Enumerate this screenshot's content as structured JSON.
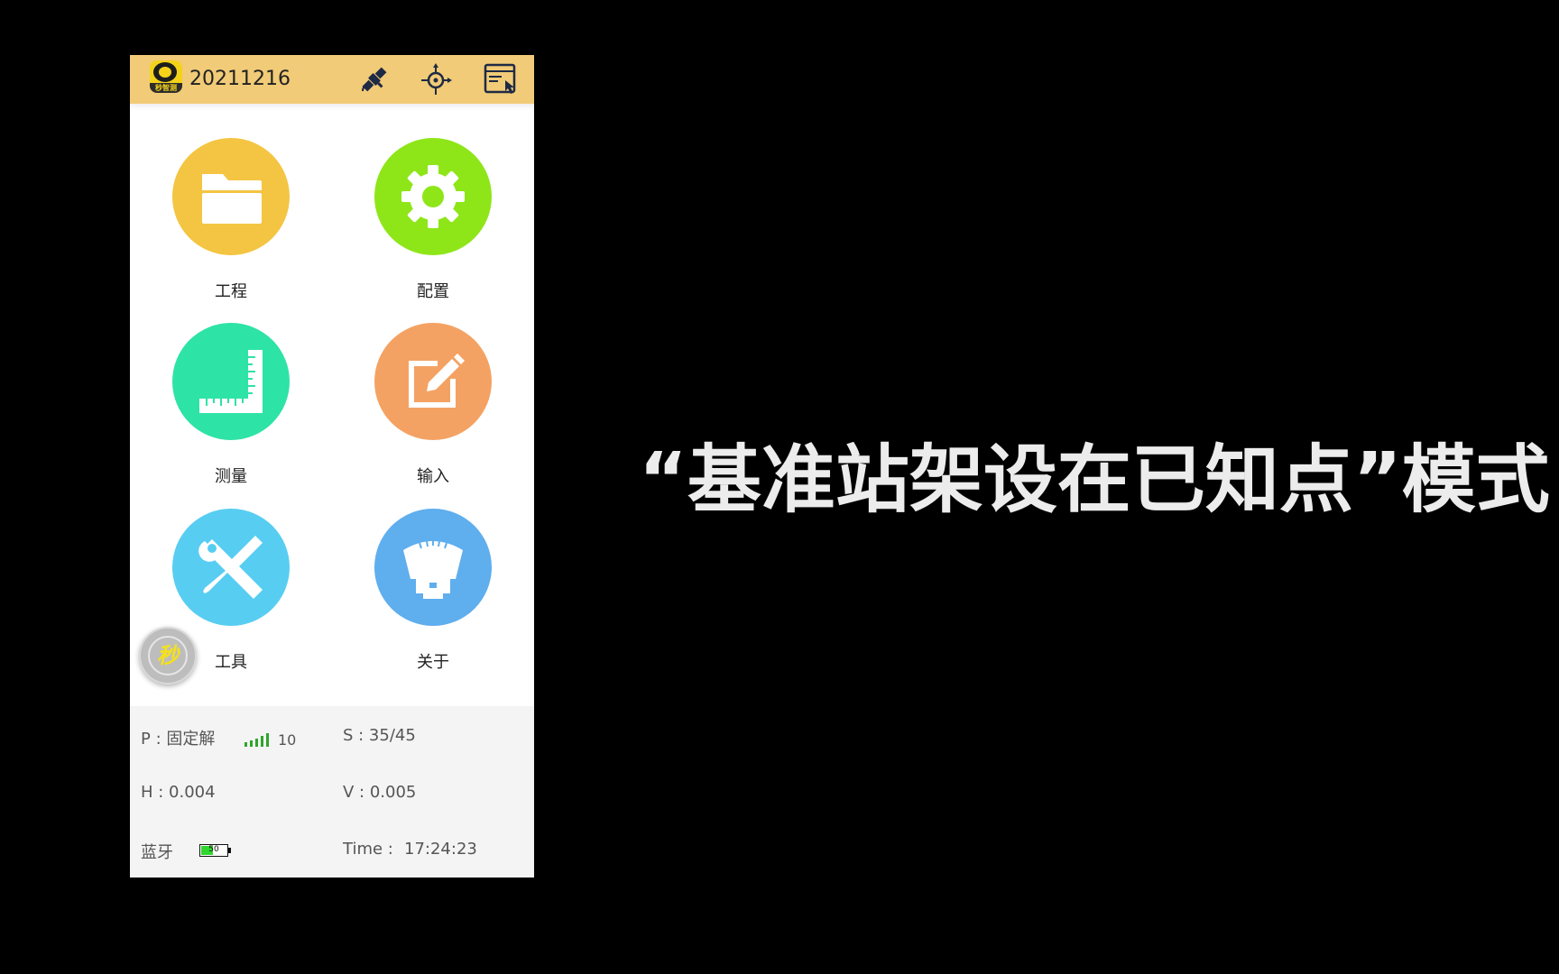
{
  "header": {
    "title": "20211216",
    "logo_text": "秒智测",
    "icons": [
      "satellite-icon",
      "crosshair-icon",
      "window-pointer-icon"
    ]
  },
  "menu": {
    "items": [
      {
        "label": "工程",
        "icon": "folder-icon",
        "color": "#f4c542"
      },
      {
        "label": "配置",
        "icon": "gear-icon",
        "color": "#8ee619"
      },
      {
        "label": "测量",
        "icon": "ruler-icon",
        "color": "#2ee3a6"
      },
      {
        "label": "输入",
        "icon": "edit-icon",
        "color": "#f4a263"
      },
      {
        "label": "工具",
        "icon": "tools-icon",
        "color": "#58cdf2"
      },
      {
        "label": "关于",
        "icon": "receiver-icon",
        "color": "#5faeee"
      }
    ]
  },
  "float_button": {
    "label": "秒"
  },
  "status": {
    "position": "P : 固定解",
    "signal_count": "10",
    "satellites": "S : 35/45",
    "h_precision": "H : 0.004",
    "v_precision": "V : 0.005",
    "bluetooth": "蓝牙",
    "battery_level": "50",
    "battery_fraction": 0.5,
    "time_label": "Time :",
    "time_value": "17:24:23"
  },
  "caption": {
    "text": "“基准站架设在已知点”模式"
  },
  "colors": {
    "background": "#000000",
    "header_bg": "#f1cb77",
    "status_bg": "#f4f4f4",
    "signal_green": "#2fa52b",
    "battery_green": "#31d62f"
  }
}
